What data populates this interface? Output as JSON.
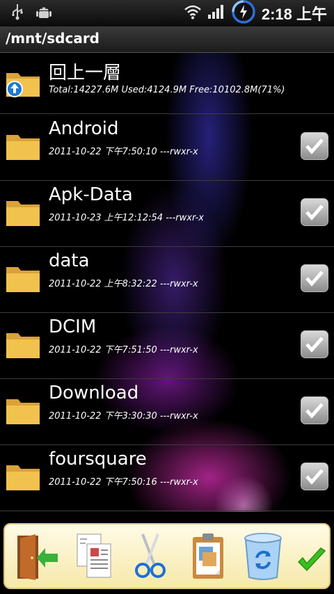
{
  "status_bar": {
    "clock": "2:18 上午",
    "icons": [
      "usb-icon",
      "android-debug-icon",
      "wifi-icon",
      "signal-icon",
      "charging-icon"
    ]
  },
  "path": "/mnt/sdcard",
  "up_entry": {
    "name": "回上一層",
    "info": "Total:14227.6M Used:4124.9M Free:10102.8M(71%)"
  },
  "folders": [
    {
      "name": "Android",
      "meta": "2011-10-22 下午7:50:10 ---rwxr-x"
    },
    {
      "name": "Apk-Data",
      "meta": "2011-10-23 上午12:12:54 ---rwxr-x"
    },
    {
      "name": "data",
      "meta": "2011-10-22 上午8:32:22 ---rwxr-x"
    },
    {
      "name": "DCIM",
      "meta": "2011-10-22 下午7:51:50 ---rwxr-x"
    },
    {
      "name": "Download",
      "meta": "2011-10-22 下午3:30:30 ---rwxr-x"
    },
    {
      "name": "foursquare",
      "meta": "2011-10-22 下午7:50:16 ---rwxr-x"
    }
  ],
  "toolbar": {
    "buttons": [
      "exit-icon",
      "copy-icon",
      "cut-icon",
      "paste-icon",
      "delete-icon",
      "confirm-icon"
    ]
  },
  "colors": {
    "folder": "#f2c24f",
    "checkbox": "#b5b5b5",
    "toolbar_bg": "#fbf1c4",
    "exit_arrow": "#38b23a",
    "confirm": "#3bbf1f"
  }
}
